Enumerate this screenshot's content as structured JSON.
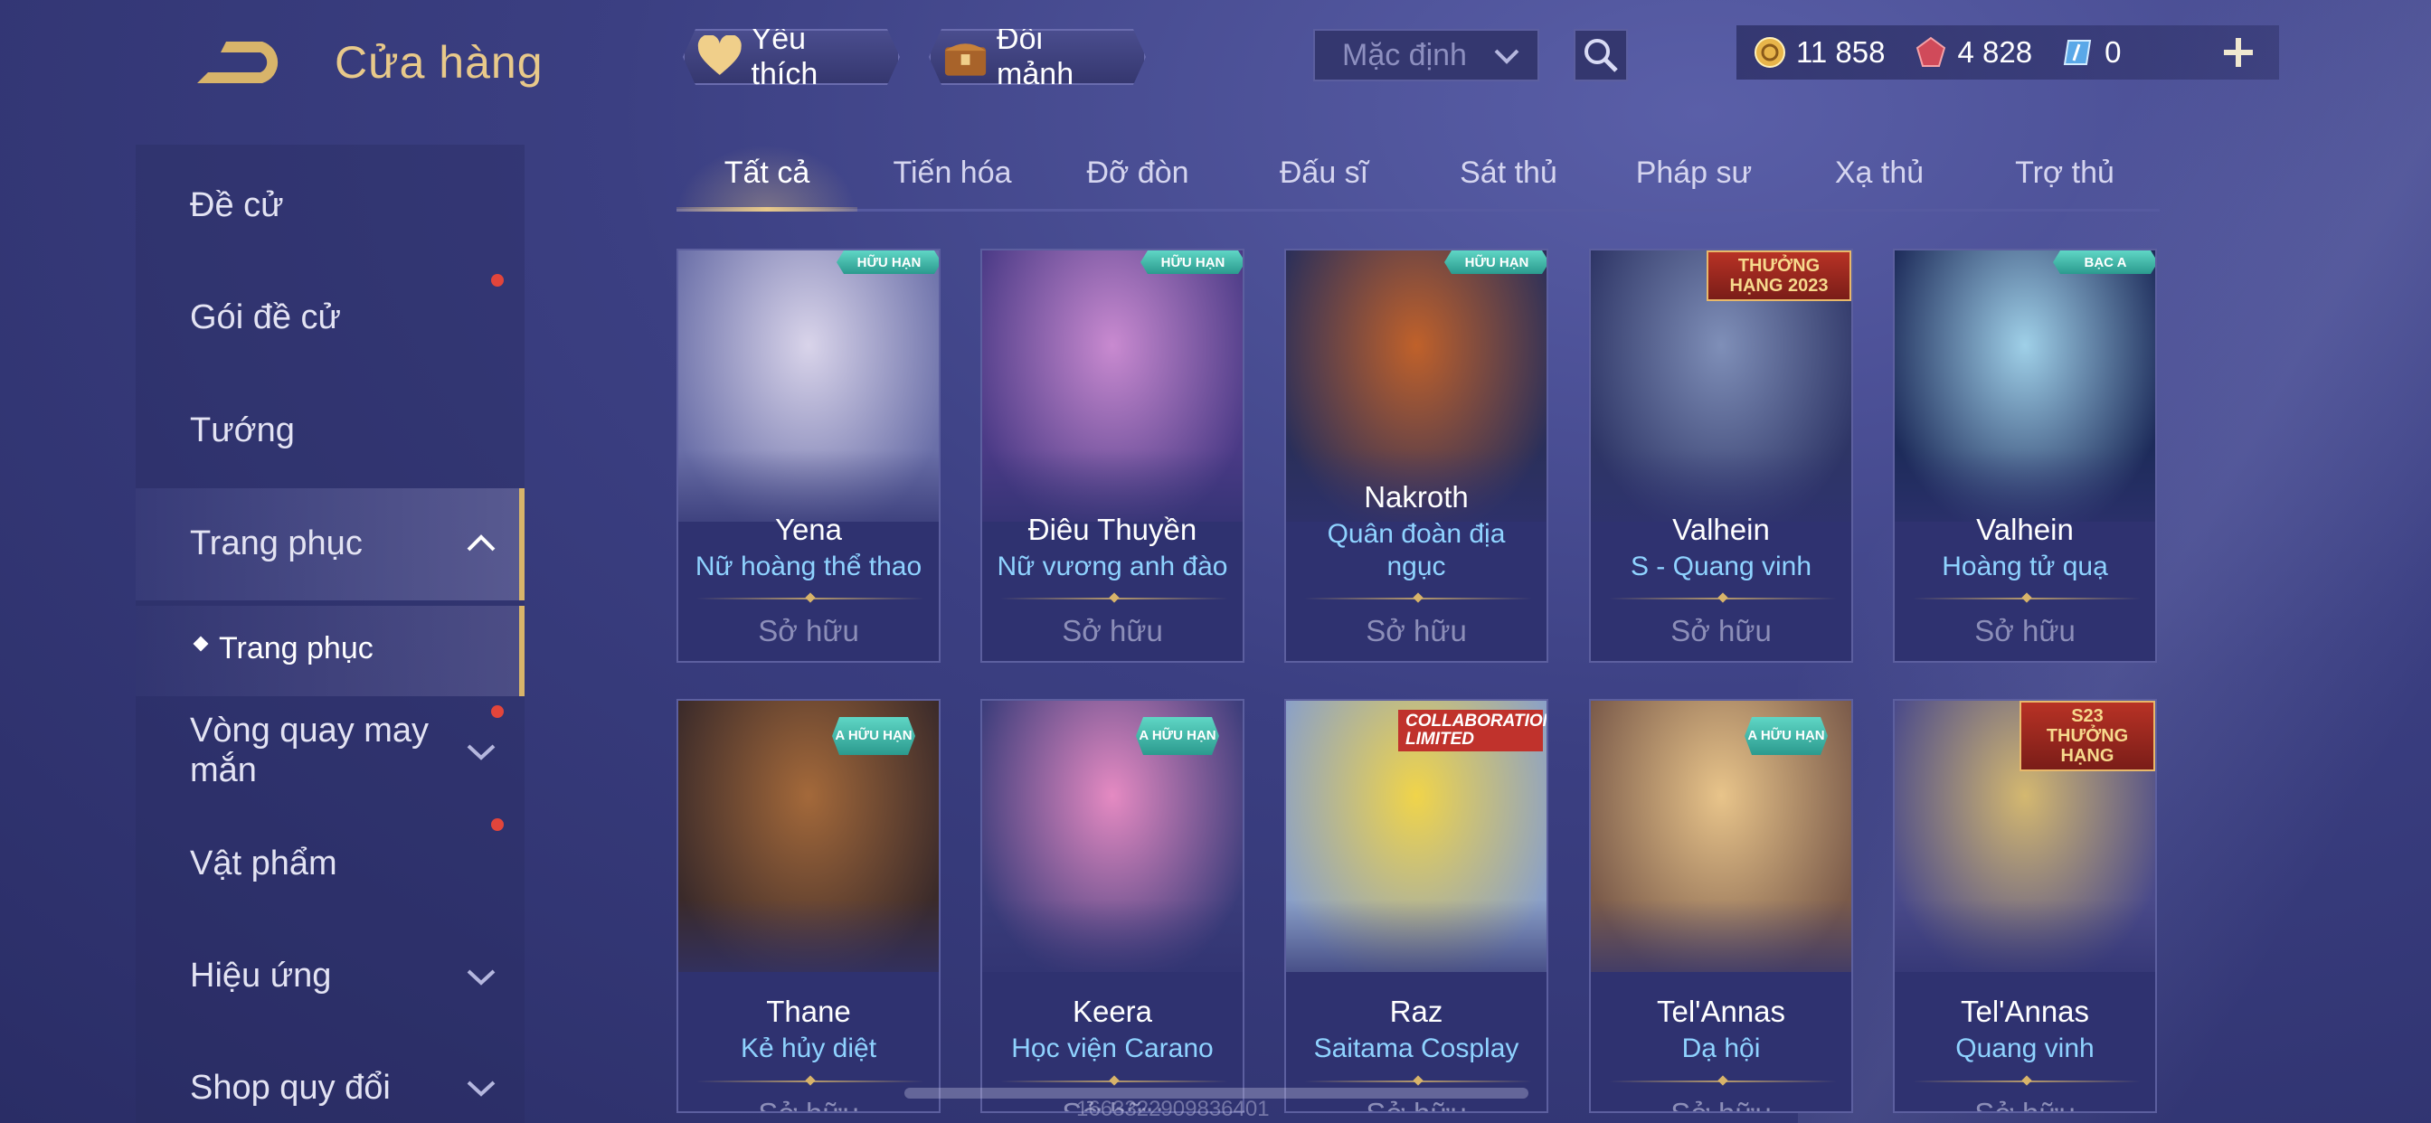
{
  "header": {
    "title": "Cửa hàng",
    "favorite_label": "Yêu thích",
    "shard_label": "Đổi mảnh",
    "sort_value": "Mặc định",
    "currency": [
      {
        "icon": "gold-coin-icon",
        "value": "11 858"
      },
      {
        "icon": "red-gem-icon",
        "value": "4 828"
      },
      {
        "icon": "blue-voucher-icon",
        "value": "0"
      }
    ]
  },
  "sidebar": {
    "items": [
      {
        "label": "Đề cử"
      },
      {
        "label": "Gói đề cử"
      },
      {
        "label": "Tướng"
      },
      {
        "label": "Trang phục"
      },
      {
        "label": "Trang phục"
      },
      {
        "label": "Vòng quay may mắn"
      },
      {
        "label": "Vật phẩm"
      },
      {
        "label": "Hiệu ứng"
      },
      {
        "label": "Shop quy đổi"
      }
    ]
  },
  "tabs": [
    "Tất cả",
    "Tiến hóa",
    "Đỡ đòn",
    "Đấu sĩ",
    "Sát thủ",
    "Pháp sư",
    "Xạ thủ",
    "Trợ thủ"
  ],
  "cards": [
    {
      "hero": "Yena",
      "skin": "Nữ hoàng thể thao",
      "status": "Sở hữu",
      "badge": "HỮU HẠN",
      "colors": [
        "#d9d4ea",
        "#6a6fa8"
      ]
    },
    {
      "hero": "Điêu Thuyền",
      "skin": "Nữ vương anh đào",
      "status": "Sở hữu",
      "badge": "HỮU HẠN",
      "colors": [
        "#c98ad0",
        "#4a3a86"
      ]
    },
    {
      "hero": "Nakroth",
      "skin": "Quân đoàn địa ngục",
      "status": "Sở hữu",
      "badge": "HỮU HẠN",
      "colors": [
        "#c0612a",
        "#2a2f5a"
      ]
    },
    {
      "hero": "Valhein",
      "skin": "S - Quang vinh",
      "status": "Sở hữu",
      "badge": "THƯỞNG HẠNG 2023",
      "colors": [
        "#7f8fb8",
        "#2e3566"
      ]
    },
    {
      "hero": "Valhein",
      "skin": "Hoàng tử quạ",
      "status": "Sở hữu",
      "badge": "BẠC A",
      "colors": [
        "#9fd0e8",
        "#1d2b5a"
      ]
    },
    {
      "hero": "Thane",
      "skin": "Kẻ hủy diệt",
      "status": "Sở hữu",
      "badge": "A HỮU HẠN",
      "colors": [
        "#a4693a",
        "#3a2a2a"
      ]
    },
    {
      "hero": "Keera",
      "skin": "Học viện Carano",
      "status": "Sở hữu",
      "badge": "A HỮU HẠN",
      "colors": [
        "#e58ac2",
        "#3a3c7a"
      ]
    },
    {
      "hero": "Raz",
      "skin": "Saitama Cosplay",
      "status": "Sở hữu",
      "badge": "COLLABORATION LIMITED",
      "colors": [
        "#f0d44a",
        "#8aa0c8"
      ]
    },
    {
      "hero": "Tel'Annas",
      "skin": "Dạ hội",
      "status": "Sở hữu",
      "badge": "A HỮU HẠN",
      "colors": [
        "#e8c48a",
        "#7a5a4a"
      ]
    },
    {
      "hero": "Tel'Annas",
      "skin": "Quang vinh",
      "status": "Sở hữu",
      "badge": "S23 THƯỞNG HẠNG",
      "colors": [
        "#d4b870",
        "#4a4a8a"
      ]
    }
  ],
  "footer": {
    "id_text": "1663322909836401"
  },
  "theme": {
    "accent": "#e8c98a",
    "skin_name_color": "#8fd3ff",
    "notification_dot": "#e2453b"
  }
}
